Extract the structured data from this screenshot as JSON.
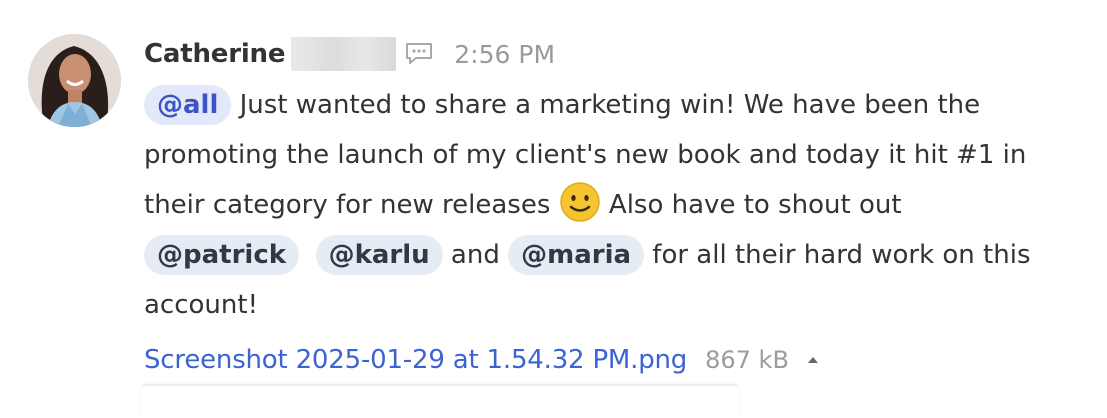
{
  "message": {
    "sender": "Catherine",
    "timestamp": "2:56 PM",
    "mention_all": "@all",
    "text_1": " Just wanted to share a marketing win! We have been the promoting the launch of my client's new book and today it hit #1 in their category for new releases ",
    "text_2": " Also have to shout out ",
    "mentions": [
      "@patrick",
      "@karlu",
      "@maria"
    ],
    "join_and": " and ",
    "text_3": " for all their hard work on this account!"
  },
  "attachment": {
    "filename": "Screenshot 2025-01-29 at 1.54.32 PM.png",
    "size": "867 kB"
  },
  "icons": {
    "avatar": "user-photo",
    "direct_message": "chat-bubble-icon",
    "emoji": "slightly-smiling-face",
    "collapse": "caret-up-icon"
  },
  "colors": {
    "link": "#3b63d4",
    "mention_all_bg": "#e3e8fb",
    "mention_bg": "#e6ecf4",
    "timestamp": "#9a9a9a"
  }
}
